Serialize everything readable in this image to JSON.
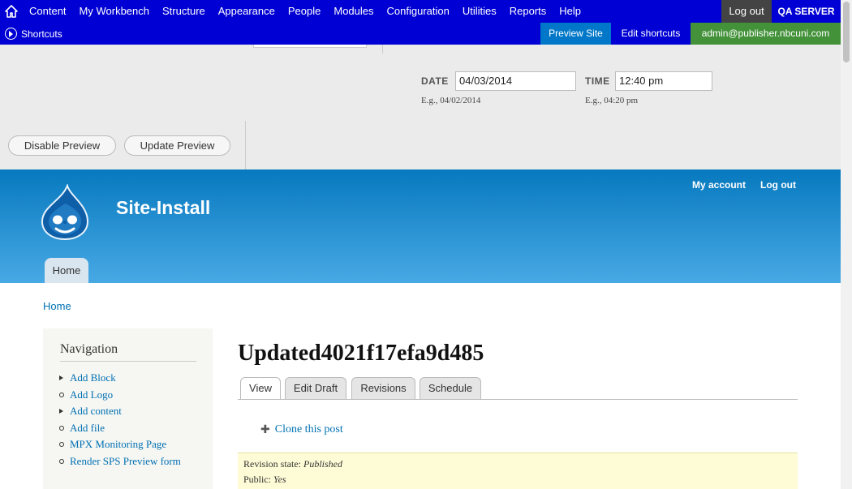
{
  "toolbar": {
    "home_icon": "home-icon",
    "menu": [
      "Content",
      "My Workbench",
      "Structure",
      "Appearance",
      "People",
      "Modules",
      "Configuration",
      "Utilities",
      "Reports",
      "Help"
    ],
    "logout": "Log out",
    "server": "QA SERVER"
  },
  "shortcuts": {
    "label": "Shortcuts",
    "preview_site": "Preview Site",
    "edit_shortcuts": "Edit shortcuts",
    "user": "admin@publisher.nbcuni.com"
  },
  "preview": {
    "date_label": "DATE",
    "date_value": "04/03/2014",
    "date_hint": "E.g., 04/02/2014",
    "time_label": "TIME",
    "time_value": "12:40 pm",
    "time_hint": "E.g., 04:20 pm",
    "disable_button": "Disable Preview",
    "update_button": "Update Preview"
  },
  "header": {
    "site_name": "Site-Install",
    "my_account": "My account",
    "log_out": "Log out",
    "home_tab": "Home"
  },
  "breadcrumb": "Home",
  "navigation": {
    "title": "Navigation",
    "items": [
      {
        "label": "Add Block",
        "bullet": "triangle"
      },
      {
        "label": "Add Logo",
        "bullet": "circle"
      },
      {
        "label": "Add content",
        "bullet": "triangle"
      },
      {
        "label": "Add file",
        "bullet": "circle"
      },
      {
        "label": "MPX Monitoring Page",
        "bullet": "circle"
      },
      {
        "label": "Render SPS Preview form",
        "bullet": "circle"
      }
    ]
  },
  "node": {
    "title": "Updated4021f17efa9d485",
    "tabs": [
      "View",
      "Edit Draft",
      "Revisions",
      "Schedule"
    ],
    "clone_link": "Clone this post",
    "revision_label": "Revision state:",
    "revision_value": "Published",
    "public_label": "Public:",
    "public_value": "Yes"
  }
}
